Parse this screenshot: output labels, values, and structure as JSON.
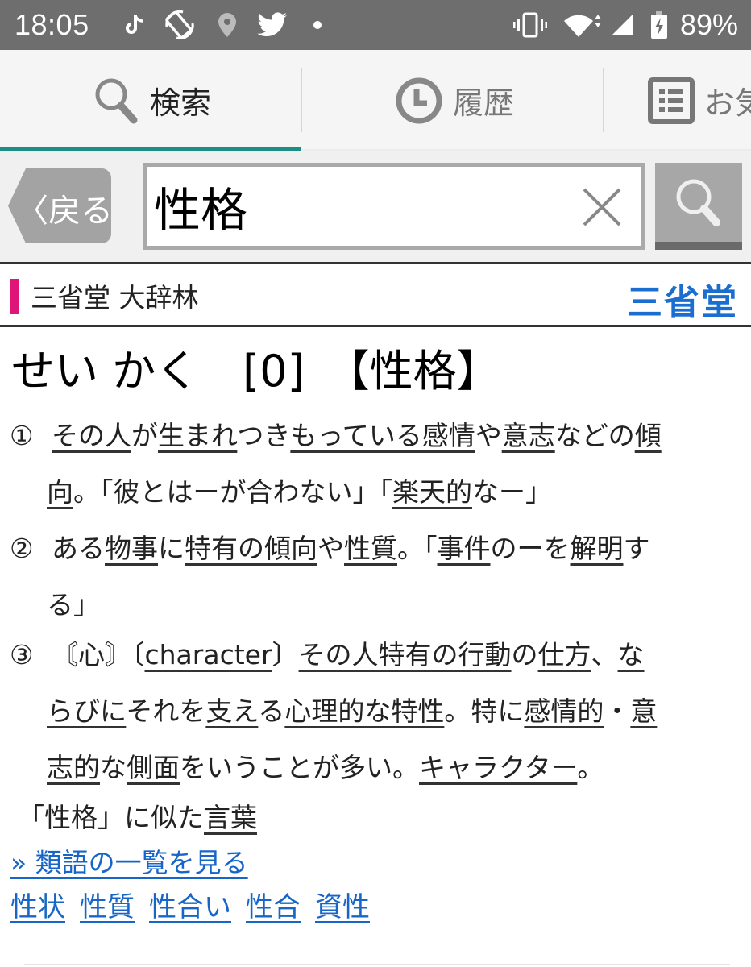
{
  "status_bar": {
    "time": "18:05",
    "left_icons": [
      "tiktok-icon",
      "auto-rotate-icon",
      "location-icon",
      "twitter-icon",
      "notification-dot-icon"
    ],
    "right_icons": [
      "vibrate-icon",
      "wifi-icon",
      "signal-icon",
      "battery-charging-icon"
    ],
    "battery_percent": "89%"
  },
  "tabs": [
    {
      "label": "検索",
      "icon": "search-icon",
      "active": true
    },
    {
      "label": "履歴",
      "icon": "clock-icon",
      "active": false
    },
    {
      "label": "お気",
      "icon": "list-icon",
      "active": false
    }
  ],
  "search": {
    "back_label": "〈戻る",
    "query": "性格",
    "clear_icon": "close-icon",
    "submit_icon": "search-icon"
  },
  "dictionary": {
    "name": "三省堂 大辞林",
    "publisher": "三省堂",
    "accent_color": "#e0157a",
    "publisher_color": "#1a6ed0"
  },
  "entry": {
    "headword": "せい かく　[0]　【性格】",
    "senses": [
      {
        "num": "①",
        "lines": [
          [
            {
              "t": "その人",
              "link": true
            },
            {
              "t": "が"
            },
            {
              "t": "生まれ",
              "link": true
            },
            {
              "t": "つき"
            },
            {
              "t": "もっている感情",
              "link": true
            },
            {
              "t": "や"
            },
            {
              "t": "意志",
              "link": true
            },
            {
              "t": "などの"
            },
            {
              "t": "傾",
              "link": true
            }
          ],
          [
            {
              "t": "向",
              "link": true
            },
            {
              "t": "。「彼とはーが合わない」「"
            },
            {
              "t": "楽天的",
              "link": true
            },
            {
              "t": "なー」"
            }
          ]
        ]
      },
      {
        "num": "②",
        "lines": [
          [
            {
              "t": "ある"
            },
            {
              "t": "物事",
              "link": true
            },
            {
              "t": "に"
            },
            {
              "t": "特有の傾向",
              "link": true
            },
            {
              "t": "や"
            },
            {
              "t": "性質",
              "link": true
            },
            {
              "t": "。「"
            },
            {
              "t": "事件",
              "link": true
            },
            {
              "t": "のーを"
            },
            {
              "t": "解明",
              "link": true
            },
            {
              "t": "す"
            }
          ],
          [
            {
              "t": "る」"
            }
          ]
        ]
      },
      {
        "num": "③",
        "lines": [
          [
            {
              "t": "〘心〙〔"
            },
            {
              "t": "character",
              "link": true
            },
            {
              "t": "〕"
            },
            {
              "t": "その人特有の行動",
              "link": true
            },
            {
              "t": "の"
            },
            {
              "t": "仕方",
              "link": true
            },
            {
              "t": "、"
            },
            {
              "t": "な",
              "link": true
            }
          ],
          [
            {
              "t": "らびに",
              "link": true
            },
            {
              "t": "それを"
            },
            {
              "t": "支え",
              "link": true
            },
            {
              "t": "る"
            },
            {
              "t": "心理的な特性",
              "link": true
            },
            {
              "t": "。特に"
            },
            {
              "t": "感情的",
              "link": true
            },
            {
              "t": "・"
            },
            {
              "t": "意",
              "link": true
            }
          ],
          [
            {
              "t": "志的",
              "link": true
            },
            {
              "t": "な"
            },
            {
              "t": "側面",
              "link": true
            },
            {
              "t": "をいうことが多い。"
            },
            {
              "t": "キャラクター",
              "link": true
            },
            {
              "t": "。"
            }
          ]
        ]
      }
    ]
  },
  "similar": {
    "label_prefix": "「性格」に似た",
    "label_link": "言葉",
    "more_link": "» 類語の一覧を見る",
    "words": [
      "性状",
      "性質",
      "性合い",
      "性合",
      "資性"
    ],
    "link_color": "#1766c7"
  }
}
